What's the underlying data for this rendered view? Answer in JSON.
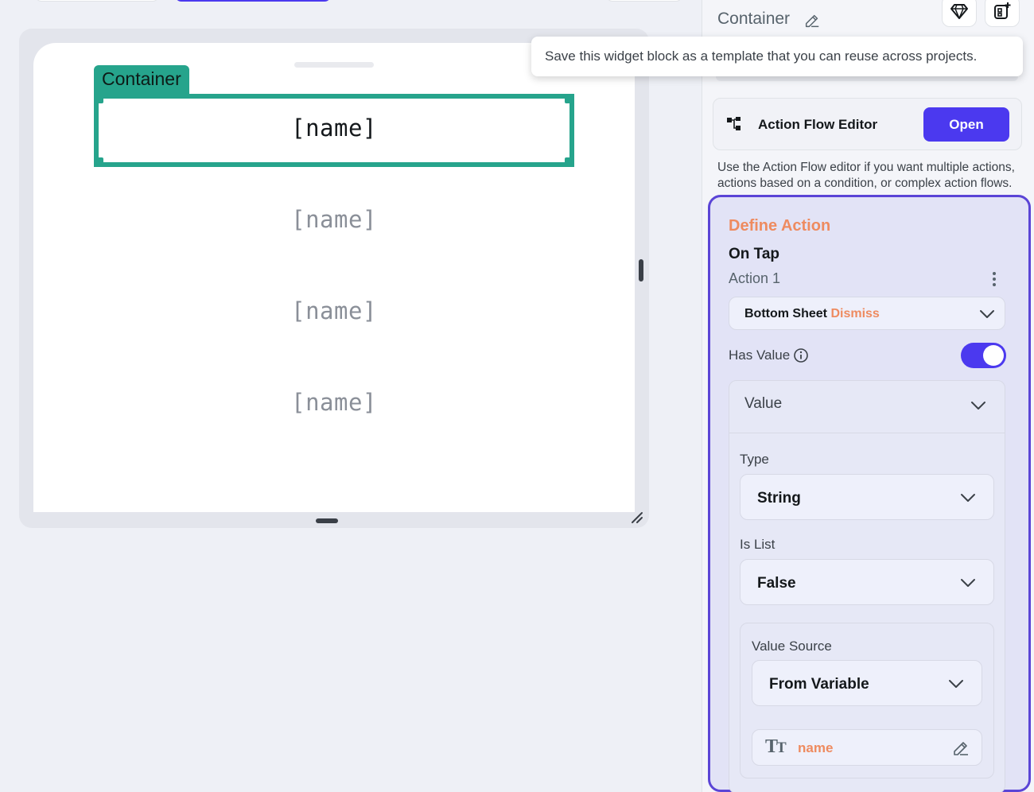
{
  "canvas": {
    "container_tag": "Container",
    "rows": [
      "[name]",
      "[name]",
      "[name]",
      "[name]"
    ]
  },
  "panel": {
    "title": "Container",
    "tooltip": "Save this widget block as a template that you can reuse across projects.",
    "action_flow_editor": {
      "label": "Action Flow Editor",
      "open_button": "Open",
      "description": "Use the Action Flow editor if you want multiple actions, actions based on a condition, or complex action flows."
    },
    "define_action": {
      "title": "Define Action",
      "trigger": "On Tap",
      "action_label": "Action 1",
      "action_type": "Bottom Sheet",
      "action_subtype": "Dismiss",
      "has_value_label": "Has Value",
      "has_value": true,
      "value_header": "Value",
      "type_label": "Type",
      "type_value": "String",
      "is_list_label": "Is List",
      "is_list_value": "False",
      "value_source_label": "Value Source",
      "value_source": "From Variable",
      "variable_name": "name"
    }
  },
  "colors": {
    "accent": "#4b39ef",
    "selection": "#26a48c",
    "highlight_text": "#ee8b60",
    "define_border": "#5b45d6"
  },
  "icons": [
    "diamond-icon",
    "add-template-icon",
    "pencil-icon",
    "action-flow-icon",
    "more-vert-icon",
    "chevron-down-icon",
    "info-icon",
    "text-type-icon",
    "resize-icon"
  ]
}
